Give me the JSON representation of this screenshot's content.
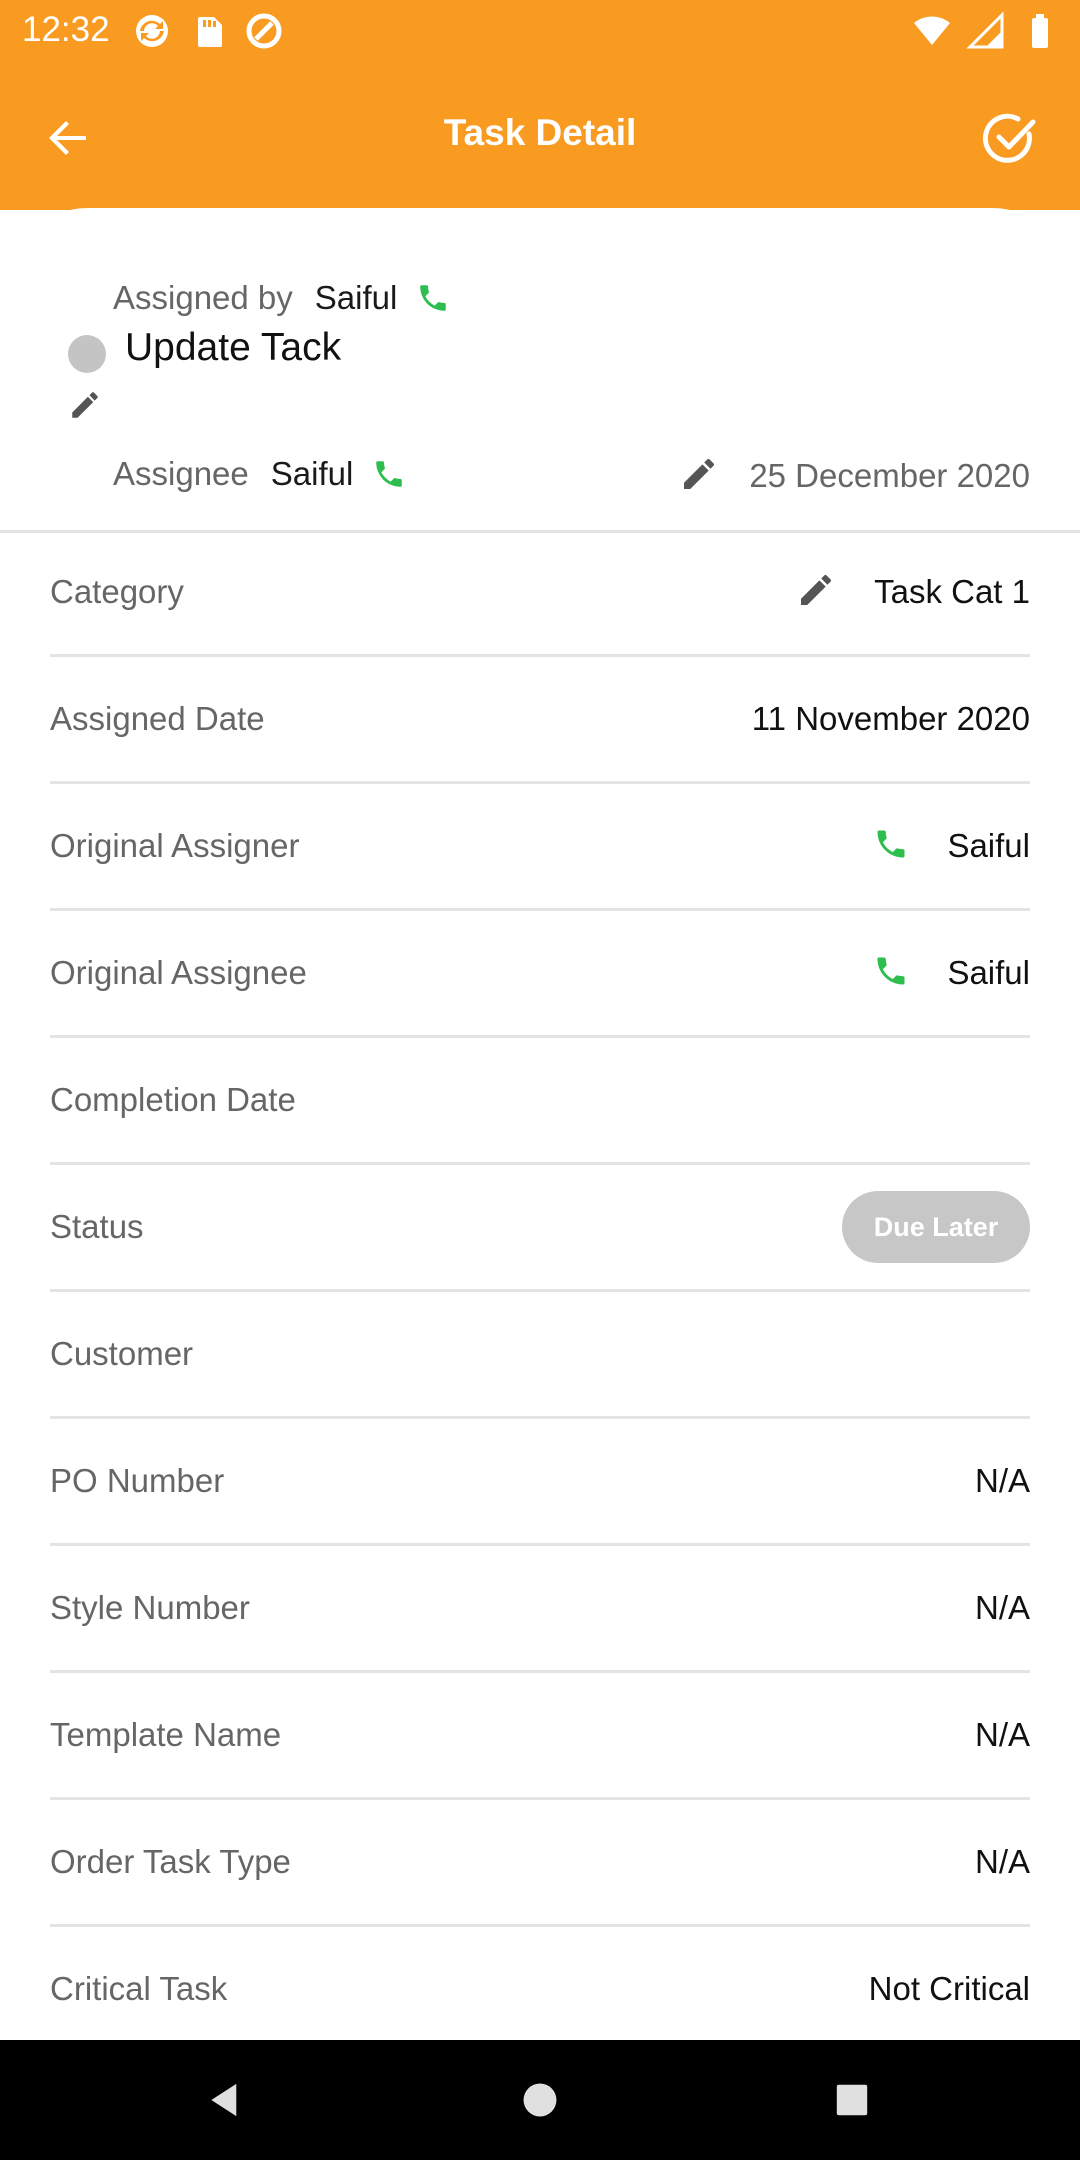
{
  "status_bar": {
    "time": "12:32"
  },
  "app_bar": {
    "title": "Task Detail",
    "back_icon": "arrow-left-icon",
    "done_icon": "check-circle-icon"
  },
  "header": {
    "assigned_by_label": "Assigned by",
    "assigned_by_name": "Saiful",
    "task_title": "Update Tack",
    "assignee_label": "Assignee",
    "assignee_name": "Saiful",
    "due_date": "25 December 2020"
  },
  "details": [
    {
      "label": "Category",
      "value": "Task Cat 1"
    },
    {
      "label": "Assigned Date",
      "value": "11 November 2020"
    },
    {
      "label": "Original Assigner",
      "value": "Saiful"
    },
    {
      "label": "Original Assignee",
      "value": "Saiful"
    },
    {
      "label": "Completion Date",
      "value": ""
    },
    {
      "label": "Status",
      "value": "Due Later"
    },
    {
      "label": "Customer",
      "value": ""
    },
    {
      "label": "PO Number",
      "value": "N/A"
    },
    {
      "label": "Style Number",
      "value": "N/A"
    },
    {
      "label": "Template Name",
      "value": "N/A"
    },
    {
      "label": "Order Task Type",
      "value": "N/A"
    },
    {
      "label": "Critical Task",
      "value": "Not Critical"
    }
  ],
  "colors": {
    "primary": "#F99A21",
    "phone_green": "#2DBE4E",
    "badge_gray": "#C7C7C7"
  }
}
